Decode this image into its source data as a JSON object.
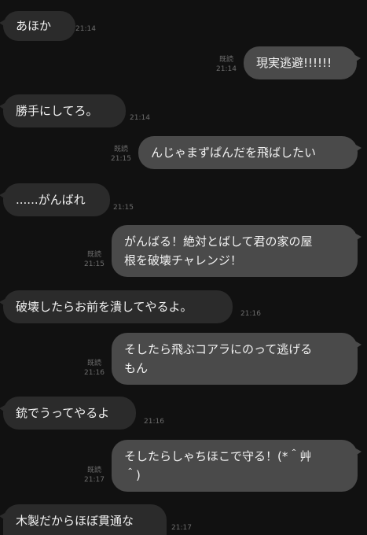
{
  "messages": [
    {
      "side": "in",
      "text": "あほか",
      "time": "21:14"
    },
    {
      "side": "out",
      "text": "現実逃避!!!!!!",
      "read": "既読",
      "time": "21:14"
    },
    {
      "side": "in",
      "text": "勝手にしてろ。",
      "time": "21:14"
    },
    {
      "side": "out",
      "text": "んじゃまずぱんだを飛ばしたい",
      "read": "既読",
      "time": "21:15"
    },
    {
      "side": "in",
      "text": "......がんばれ",
      "time": "21:15"
    },
    {
      "side": "out",
      "text": "がんばる！絶対とばして君の家の屋\n根を破壊チャレンジ！",
      "read": "既読",
      "time": "21:15"
    },
    {
      "side": "in",
      "text": "破壊したらお前を潰してやるよ。",
      "time": "21:16"
    },
    {
      "side": "out",
      "text": "そしたら飛ぶコアラにのって逃げる\nもん",
      "read": "既読",
      "time": "21:16"
    },
    {
      "side": "in",
      "text": "銃でうってやるよ",
      "time": "21:16"
    },
    {
      "side": "out",
      "text": "そしたらしゃちほこで守る！(*＾艸\n＾)",
      "read": "既読",
      "time": "21:17"
    },
    {
      "side": "in",
      "text": "木製だからほぼ貫通な",
      "time": "21:17"
    }
  ]
}
